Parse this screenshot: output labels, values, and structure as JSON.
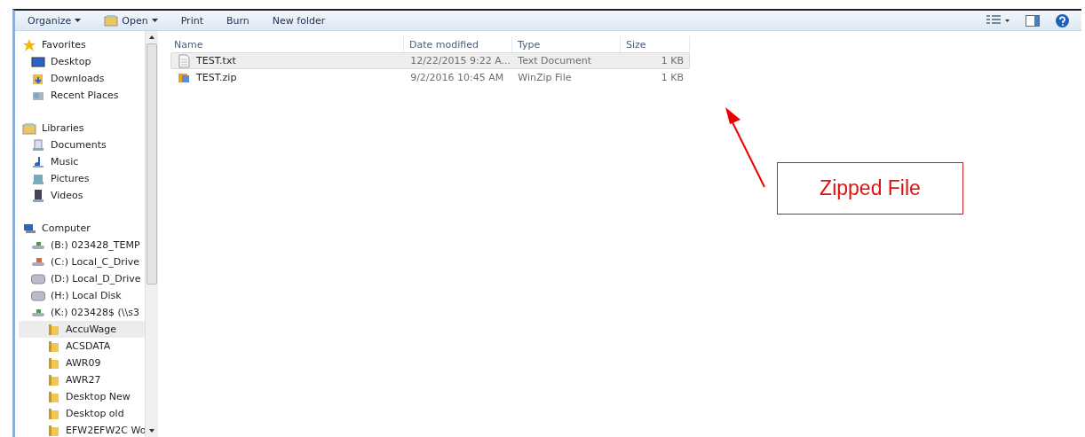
{
  "toolbar": {
    "buttons": [
      {
        "label": "Organize",
        "kind": "menu"
      },
      {
        "label": "Open",
        "kind": "open"
      },
      {
        "label": "Print",
        "kind": "plain"
      },
      {
        "label": "Burn",
        "kind": "plain"
      },
      {
        "label": "New folder",
        "kind": "plain"
      }
    ]
  },
  "sidebar": {
    "groups": [
      {
        "label": "Favorites",
        "kind": "star",
        "children": [
          {
            "label": "Desktop",
            "kind": "desktop",
            "selected": false
          },
          {
            "label": "Downloads",
            "kind": "downloads",
            "selected": false
          },
          {
            "label": "Recent Places",
            "kind": "recent",
            "selected": false
          }
        ]
      },
      {
        "label": "Libraries",
        "kind": "library",
        "children": [
          {
            "label": "Documents",
            "kind": "documents",
            "selected": false
          },
          {
            "label": "Music",
            "kind": "music",
            "selected": false
          },
          {
            "label": "Pictures",
            "kind": "pictures",
            "selected": false
          },
          {
            "label": "Videos",
            "kind": "videos",
            "selected": false
          }
        ]
      },
      {
        "label": "Computer",
        "kind": "computer",
        "children": [
          {
            "label": "(B:) 023428_TEMP",
            "kind": "netdrive",
            "selected": false
          },
          {
            "label": "(C:) Local_C_Drive",
            "kind": "sysdrive",
            "selected": false
          },
          {
            "label": "(D:) Local_D_Drive",
            "kind": "drive",
            "selected": false
          },
          {
            "label": "(H:) Local Disk",
            "kind": "drive",
            "selected": false
          },
          {
            "label": "(K:) 023428$ (\\\\s3",
            "kind": "netdrive",
            "selected": false,
            "children": [
              {
                "label": "AccuWage",
                "kind": "folder",
                "selected": true
              },
              {
                "label": "ACSDATA",
                "kind": "folder",
                "selected": false
              },
              {
                "label": "AWR09",
                "kind": "folder",
                "selected": false
              },
              {
                "label": "AWR27",
                "kind": "folder",
                "selected": false
              },
              {
                "label": "Desktop New",
                "kind": "folder",
                "selected": false
              },
              {
                "label": "Desktop old",
                "kind": "folder",
                "selected": false
              },
              {
                "label": "EFW2EFW2C Wo",
                "kind": "folder",
                "selected": false
              }
            ]
          }
        ]
      }
    ]
  },
  "table": {
    "columns": [
      "Name",
      "Date modified",
      "Type",
      "Size"
    ],
    "rows": [
      {
        "name": "TEST.txt",
        "kind": "text",
        "date": "12/22/2015 9:22 A...",
        "type": "Text Document",
        "size": "1 KB",
        "selected": true
      },
      {
        "name": "TEST.zip",
        "kind": "zip",
        "date": "9/2/2016 10:45 AM",
        "type": "WinZip File",
        "size": "1 KB",
        "selected": false
      }
    ]
  },
  "callout": {
    "text": "Zipped File"
  }
}
